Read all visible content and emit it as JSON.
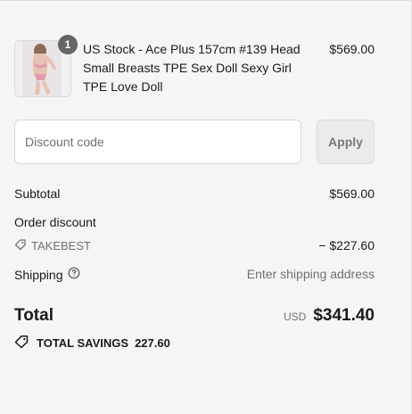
{
  "product": {
    "title": "US Stock - Ace Plus 157cm #139 Head Small Breasts TPE Sex Doll Sexy Girl TPE Love Doll",
    "price": "$569.00",
    "quantity": "1"
  },
  "discount": {
    "placeholder": "Discount code",
    "apply_label": "Apply"
  },
  "summary": {
    "subtotal_label": "Subtotal",
    "subtotal_value": "$569.00",
    "order_discount_label": "Order discount",
    "code": "TAKEBEST",
    "code_value": "− $227.60",
    "shipping_label": "Shipping",
    "shipping_value": "Enter shipping address"
  },
  "total": {
    "label": "Total",
    "currency": "USD",
    "amount": "$341.40"
  },
  "savings": {
    "label": "TOTAL SAVINGS",
    "amount": "227.60"
  },
  "icons": {
    "tag": "tag-icon",
    "help": "help-circle-icon",
    "savings": "savings-tag-icon"
  }
}
